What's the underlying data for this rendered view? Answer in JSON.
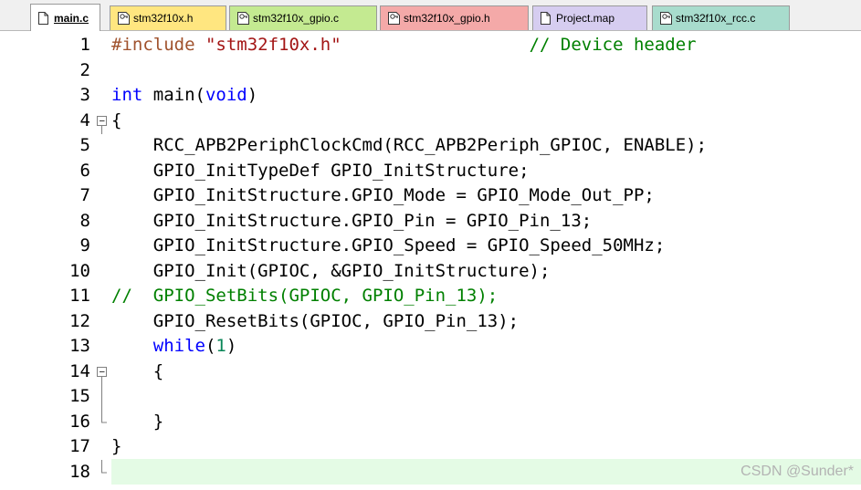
{
  "tabs": [
    {
      "label": "main.c",
      "icon": "file-icon",
      "active": true,
      "color": "#ffffff"
    },
    {
      "label": "stm32f10x.h",
      "icon": "header-file-icon",
      "active": false,
      "color": "#ffe680"
    },
    {
      "label": "stm32f10x_gpio.c",
      "icon": "source-file-icon",
      "active": false,
      "color": "#c4ea91"
    },
    {
      "label": "stm32f10x_gpio.h",
      "icon": "header-file-icon",
      "active": false,
      "color": "#f4a9a8"
    },
    {
      "label": "Project.map",
      "icon": "file-icon",
      "active": false,
      "color": "#d6cdf0"
    },
    {
      "label": "stm32f10x_rcc.c",
      "icon": "source-file-icon",
      "active": false,
      "color": "#a8dccd"
    }
  ],
  "editor": {
    "line_numbers": [
      "1",
      "2",
      "3",
      "4",
      "5",
      "6",
      "7",
      "8",
      "9",
      "10",
      "11",
      "12",
      "13",
      "14",
      "15",
      "16",
      "17",
      "18"
    ],
    "lines": [
      "#include \"stm32f10x.h\"                  // Device header",
      "",
      "int main(void)",
      "{",
      "    RCC_APB2PeriphClockCmd(RCC_APB2Periph_GPIOC, ENABLE);",
      "    GPIO_InitTypeDef GPIO_InitStructure;",
      "    GPIO_InitStructure.GPIO_Mode = GPIO_Mode_Out_PP;",
      "    GPIO_InitStructure.GPIO_Pin = GPIO_Pin_13;",
      "    GPIO_InitStructure.GPIO_Speed = GPIO_Speed_50MHz;",
      "    GPIO_Init(GPIOC, &GPIO_InitStructure);",
      "//  GPIO_SetBits(GPIOC, GPIO_Pin_13);",
      "    GPIO_ResetBits(GPIOC, GPIO_Pin_13);",
      "    while(1)",
      "    {",
      "",
      "    }",
      "}",
      ""
    ],
    "current_line": 18,
    "colors": {
      "keyword": "#0000ff",
      "string": "#a31515",
      "comment": "#008000",
      "number": "#098658",
      "current_line_bg": "#e4fbe5"
    }
  },
  "watermark": "CSDN @Sunder*"
}
